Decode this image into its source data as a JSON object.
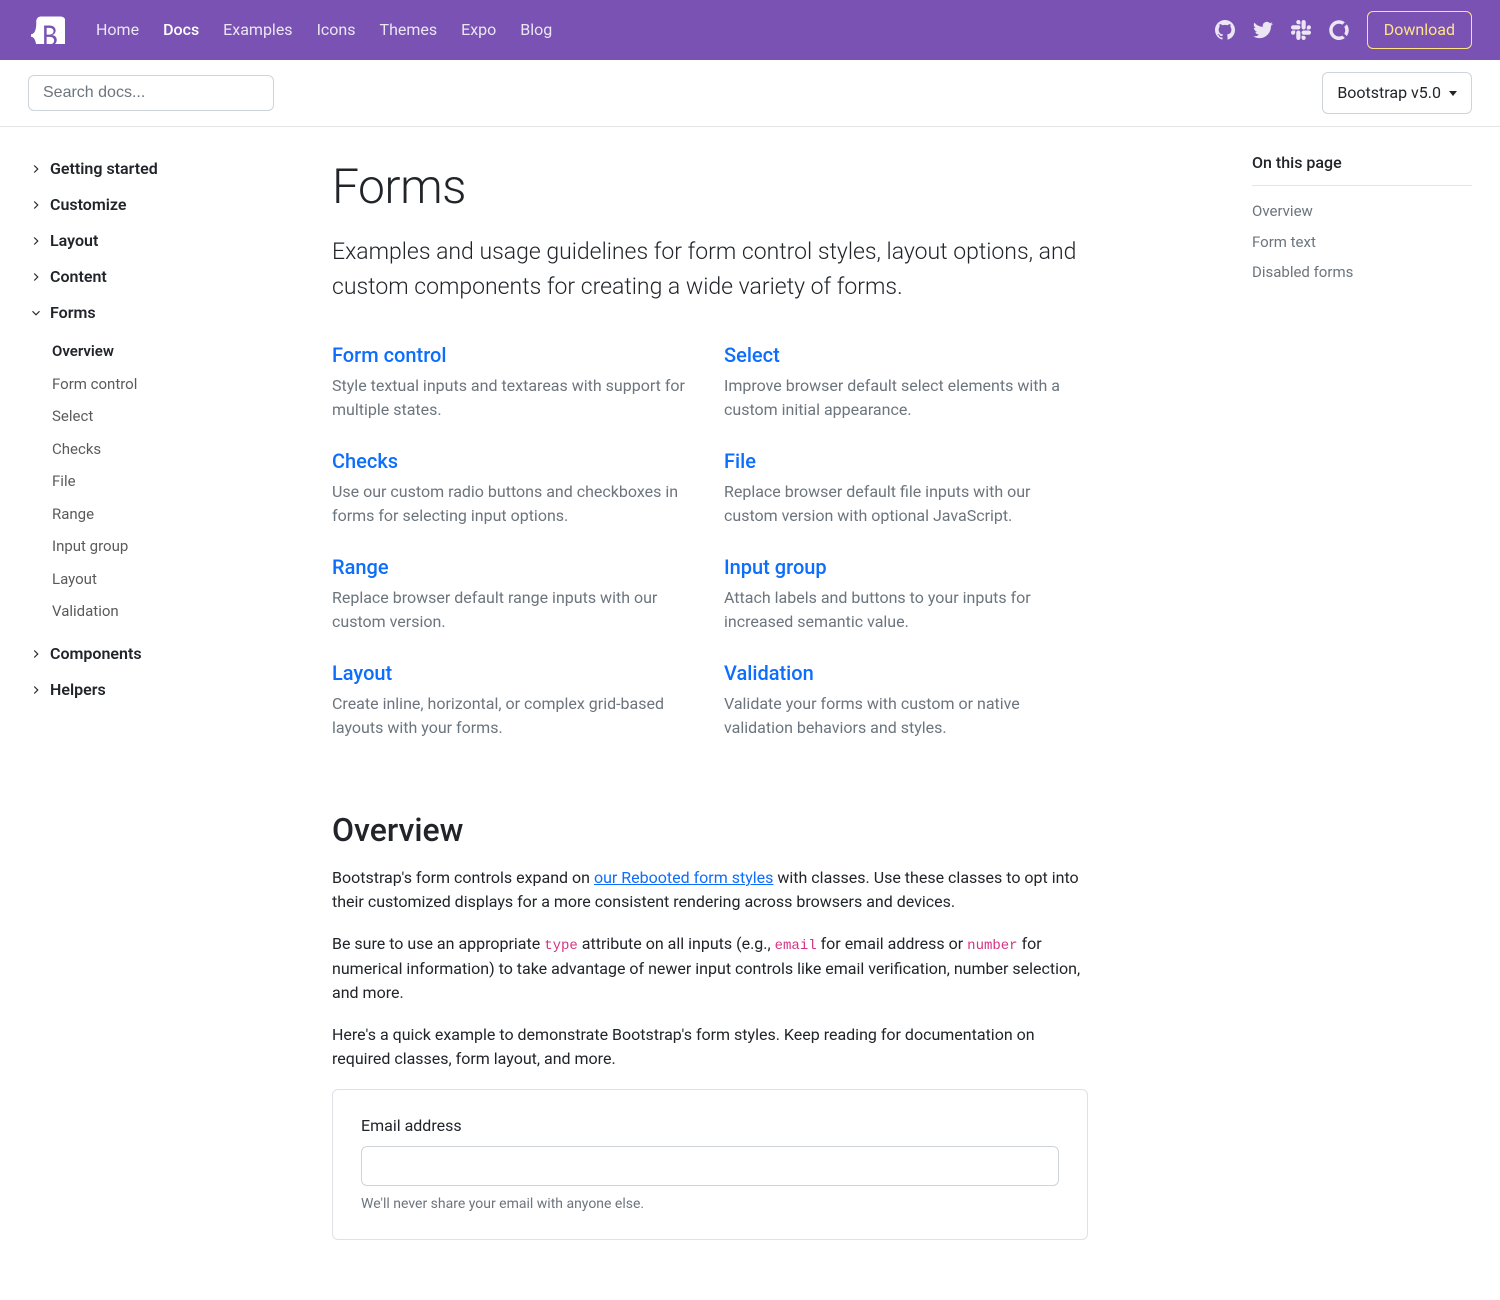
{
  "navbar": {
    "links": [
      "Home",
      "Docs",
      "Examples",
      "Icons",
      "Themes",
      "Expo",
      "Blog"
    ],
    "active_index": 1,
    "download": "Download"
  },
  "subbar": {
    "search_placeholder": "Search docs...",
    "version": "Bootstrap v5.0"
  },
  "sidebar": {
    "sections": [
      {
        "label": "Getting started",
        "expanded": false
      },
      {
        "label": "Customize",
        "expanded": false
      },
      {
        "label": "Layout",
        "expanded": false
      },
      {
        "label": "Content",
        "expanded": false
      },
      {
        "label": "Forms",
        "expanded": true,
        "items": [
          "Overview",
          "Form control",
          "Select",
          "Checks",
          "File",
          "Range",
          "Input group",
          "Layout",
          "Validation"
        ],
        "active_item": 0
      },
      {
        "label": "Components",
        "expanded": false
      },
      {
        "label": "Helpers",
        "expanded": false
      }
    ]
  },
  "page": {
    "title": "Forms",
    "lead": "Examples and usage guidelines for form control styles, layout options, and custom components for creating a wide variety of forms.",
    "cards": [
      {
        "title": "Form control",
        "desc": "Style textual inputs and textareas with support for multiple states."
      },
      {
        "title": "Select",
        "desc": "Improve browser default select elements with a custom initial appearance."
      },
      {
        "title": "Checks",
        "desc": "Use our custom radio buttons and checkboxes in forms for selecting input options."
      },
      {
        "title": "File",
        "desc": "Replace browser default file inputs with our custom version with optional JavaScript."
      },
      {
        "title": "Range",
        "desc": "Replace browser default range inputs with our custom version."
      },
      {
        "title": "Input group",
        "desc": "Attach labels and buttons to your inputs for increased semantic value."
      },
      {
        "title": "Layout",
        "desc": "Create inline, horizontal, or complex grid-based layouts with your forms."
      },
      {
        "title": "Validation",
        "desc": "Validate your forms with custom or native validation behaviors and styles."
      }
    ],
    "overview": {
      "heading": "Overview",
      "p1_a": "Bootstrap's form controls expand on ",
      "p1_link": "our Rebooted form styles",
      "p1_b": " with classes. Use these classes to opt into their customized displays for a more consistent rendering across browsers and devices.",
      "p2_a": "Be sure to use an appropriate ",
      "p2_code1": "type",
      "p2_b": " attribute on all inputs (e.g., ",
      "p2_code2": "email",
      "p2_c": " for email address or ",
      "p2_code3": "number",
      "p2_d": " for numerical information) to take advantage of newer input controls like email verification, number selection, and more.",
      "p3": "Here's a quick example to demonstrate Bootstrap's form styles. Keep reading for documentation on required classes, form layout, and more."
    },
    "example": {
      "email_label": "Email address",
      "email_hint": "We'll never share your email with anyone else."
    }
  },
  "toc": {
    "heading": "On this page",
    "items": [
      "Overview",
      "Form text",
      "Disabled forms"
    ]
  }
}
